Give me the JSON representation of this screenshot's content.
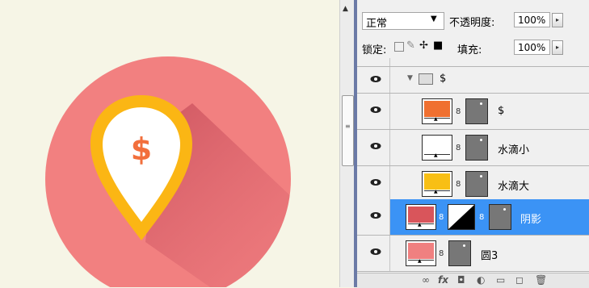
{
  "panel": {
    "blend_mode": "正常",
    "opacity_label": "不透明度:",
    "opacity_value": "100%",
    "lock_label": "锁定:",
    "fill_label": "填充:",
    "fill_value": "100%"
  },
  "layers": [
    {
      "name": "$",
      "kind": "group"
    },
    {
      "name": "$",
      "kind": "layer",
      "color": "#f07030"
    },
    {
      "name": "水滴小",
      "kind": "layer",
      "color": "#ffffff"
    },
    {
      "name": "水滴大",
      "kind": "layer",
      "color": "#f8bf14"
    },
    {
      "name": "阴影",
      "kind": "layer",
      "color": "#d9555b",
      "selected": true
    },
    {
      "name": "圆3",
      "kind": "layer",
      "color": "#f08080"
    }
  ],
  "canvas": {
    "pin_symbol": "$",
    "colors": {
      "background": "#f6f5e6",
      "circle": "#f28080",
      "pin": "#fbb614",
      "pin_inner": "#ffffff",
      "dollar": "#f26f3c",
      "shadow": "#d05a65"
    }
  },
  "bottombar": {
    "fx": "fx"
  }
}
